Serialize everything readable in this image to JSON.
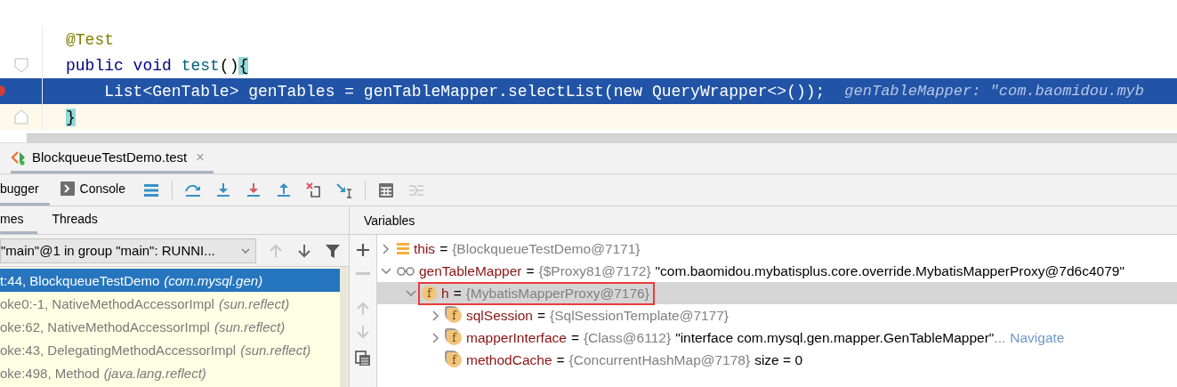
{
  "editor": {
    "lines": [
      {
        "kind": "plain",
        "current": false,
        "breakpoint": false,
        "tokens": [
          {
            "kind": "annotation",
            "text": "@Test"
          }
        ]
      },
      {
        "kind": "fold-start",
        "current": false,
        "breakpoint": false,
        "tokens": [
          {
            "kind": "keyword",
            "text": "public void "
          },
          {
            "kind": "method",
            "text": "test"
          },
          {
            "kind": "plain",
            "text": "()"
          },
          {
            "kind": "brace",
            "text": "{"
          }
        ]
      },
      {
        "kind": "plain",
        "current": true,
        "breakpoint": true,
        "tokens": [
          {
            "kind": "plain",
            "text": "    List<GenTable> genTables = genTableMapper.selectList(new QueryWrapper<>());"
          },
          {
            "kind": "hint",
            "text": "genTableMapper: \"com.baomidou.myb"
          }
        ]
      },
      {
        "kind": "fold-end",
        "current": false,
        "breakpoint": false,
        "tokens": [
          {
            "kind": "brace",
            "text": "}"
          }
        ]
      }
    ]
  },
  "debug_tab": {
    "title": "BlockqueueTestDemo.test",
    "close": "×"
  },
  "toolbar": {
    "tabs": [
      {
        "label": "bugger",
        "selected": true
      },
      {
        "label": "Console",
        "selected": false
      }
    ],
    "buttons": [
      {
        "kind": "layout",
        "disabled": false
      },
      {
        "kind": "step-over",
        "disabled": false
      },
      {
        "kind": "step-into",
        "disabled": false
      },
      {
        "kind": "force-step-into",
        "disabled": false
      },
      {
        "kind": "step-out",
        "disabled": false
      },
      {
        "kind": "drop-frame",
        "disabled": false
      },
      {
        "kind": "run-to-cursor",
        "disabled": false
      },
      {
        "kind": "evaluate",
        "disabled": false
      },
      {
        "kind": "trace",
        "disabled": true
      }
    ]
  },
  "frames_panel": {
    "tabs": [
      {
        "label": "mes",
        "selected": true
      },
      {
        "label": "Threads",
        "selected": false
      }
    ],
    "thread": "\"main\"@1 in group \"main\": RUNNI...",
    "nav": [
      {
        "kind": "up",
        "disabled": true
      },
      {
        "kind": "down",
        "disabled": false
      },
      {
        "kind": "filter",
        "disabled": false
      }
    ],
    "frames": [
      {
        "location": "t:44, BlockqueueTestDemo",
        "package": "(com.mysql.gen)",
        "selected": true
      },
      {
        "location": "oke0:-1, NativeMethodAccessorImpl",
        "package": "(sun.reflect)",
        "selected": false
      },
      {
        "location": "oke:62, NativeMethodAccessorImpl",
        "package": "(sun.reflect)",
        "selected": false
      },
      {
        "location": "oke:43, DelegatingMethodAccessorImpl",
        "package": "(sun.reflect)",
        "selected": false
      },
      {
        "location": "oke:498, Method",
        "package": "(java.lang.reflect)",
        "selected": false
      }
    ]
  },
  "variables_panel": {
    "title": "Variables",
    "side_buttons": [
      {
        "kind": "add",
        "disabled": false
      },
      {
        "kind": "remove",
        "disabled": true
      },
      {
        "kind": "up",
        "disabled": true
      },
      {
        "kind": "down",
        "disabled": true
      },
      {
        "kind": "copy",
        "disabled": false
      }
    ],
    "tree": [
      {
        "kind": "object",
        "name": "this",
        "assign": "=",
        "value": "{BlockqueueTestDemo@7171}",
        "expanded": false,
        "selected": false,
        "outlined": false
      },
      {
        "kind": "watch",
        "name": "genTableMapper",
        "assign": "=",
        "value": "{$Proxy81@7172}",
        "string": "\"com.baomidou.mybatisplus.core.override.MybatisMapperProxy@7d6c4079\"",
        "expanded": true,
        "selected": false,
        "outlined": false,
        "children": [
          {
            "kind": "field",
            "badge": "f",
            "name": "h",
            "assign": "=",
            "value": "{MybatisMapperProxy@7176}",
            "expanded": true,
            "selected": true,
            "outlined": true,
            "children": [
              {
                "kind": "final-field",
                "badge": "f",
                "name": "sqlSession",
                "assign": "=",
                "value": "{SqlSessionTemplate@7177}",
                "expanded": false,
                "selected": false,
                "outlined": false
              },
              {
                "kind": "final-field",
                "badge": "f",
                "name": "mapperInterface",
                "assign": "=",
                "value": "{Class@6112}",
                "string": "\"interface com.mysql.gen.mapper.GenTableMapper\"",
                "ellipsis": "...",
                "link": "Navigate",
                "expanded": false,
                "selected": false,
                "outlined": false
              },
              {
                "kind": "final-field",
                "badge": "f",
                "name": "methodCache",
                "assign": "=",
                "value": "{ConcurrentHashMap@7178}",
                "extra": "size = 0",
                "selected": false,
                "outlined": false
              }
            ]
          }
        ]
      }
    ]
  }
}
